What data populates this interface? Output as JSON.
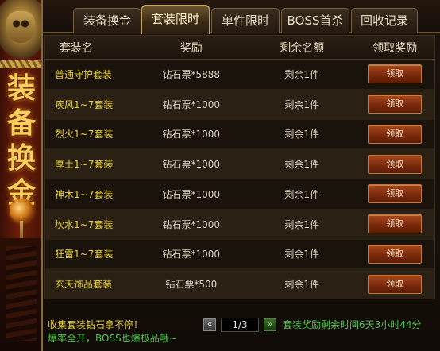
{
  "banner": {
    "chars": [
      "装",
      "备",
      "换",
      "金"
    ]
  },
  "tabs": [
    {
      "label": "装备换金",
      "active": false
    },
    {
      "label": "套装限时",
      "active": true
    },
    {
      "label": "单件限时",
      "active": false
    },
    {
      "label": "BOSS首杀",
      "active": false
    },
    {
      "label": "回收记录",
      "active": false
    }
  ],
  "table": {
    "headers": {
      "name": "套装名",
      "reward": "奖励",
      "remain": "剩余名额",
      "claim": "领取奖励"
    },
    "rows": [
      {
        "name": "普通守护套装",
        "reward": "钻石票*5888",
        "remain": "剩余1件",
        "claim": "领取"
      },
      {
        "name": "疾风1~7套装",
        "reward": "钻石票*1000",
        "remain": "剩余1件",
        "claim": "领取"
      },
      {
        "name": "烈火1~7套装",
        "reward": "钻石票*1000",
        "remain": "剩余1件",
        "claim": "领取"
      },
      {
        "name": "厚土1~7套装",
        "reward": "钻石票*1000",
        "remain": "剩余1件",
        "claim": "领取"
      },
      {
        "name": "神木1~7套装",
        "reward": "钻石票*1000",
        "remain": "剩余1件",
        "claim": "领取"
      },
      {
        "name": "坎水1~7套装",
        "reward": "钻石票*1000",
        "remain": "剩余1件",
        "claim": "领取"
      },
      {
        "name": "狂雷1~7套装",
        "reward": "钻石票*1000",
        "remain": "剩余1件",
        "claim": "领取"
      },
      {
        "name": "玄天饰品套装",
        "reward": "钻石票*500",
        "remain": "剩余1件",
        "claim": "领取"
      }
    ]
  },
  "footer": {
    "line1": "收集套装钻石拿不停！",
    "line2": "爆率全开，BOSS也爆极品哦~",
    "countdown": "套装奖励剩余时间6天3小时44分"
  },
  "pager": {
    "prev_icon": "double-chevron-left-icon",
    "next_icon": "double-chevron-right-icon",
    "page_text": "1/3"
  },
  "colors": {
    "item_name": "#e8d23a",
    "notice_green": "#4fc84a",
    "banner_gold": "#f7cf5a",
    "button_red": "#7a2a0c"
  }
}
